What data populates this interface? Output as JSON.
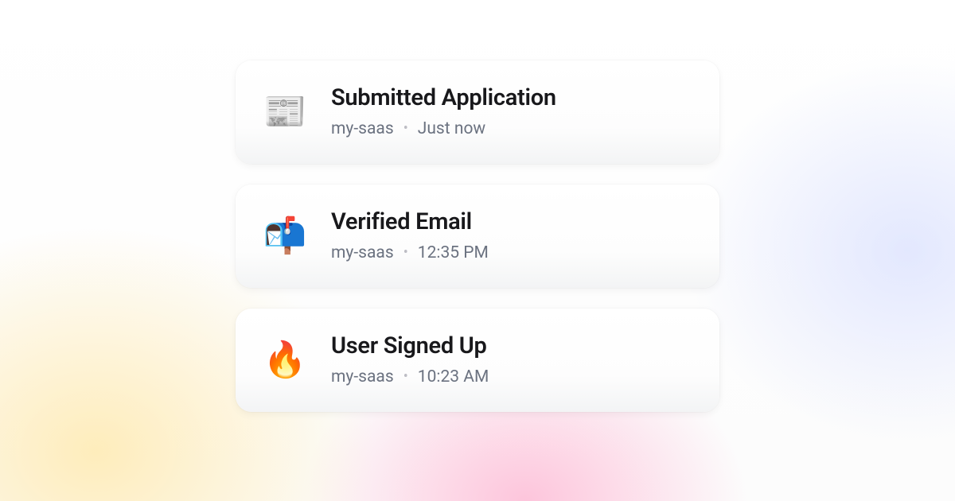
{
  "events": [
    {
      "icon": "📰",
      "title": "Submitted Application",
      "source": "my-saas",
      "time": "Just now"
    },
    {
      "icon": "📬",
      "title": "Verified Email",
      "source": "my-saas",
      "time": "12:35 PM"
    },
    {
      "icon": "🔥",
      "title": "User Signed Up",
      "source": "my-saas",
      "time": "10:23 AM"
    }
  ]
}
